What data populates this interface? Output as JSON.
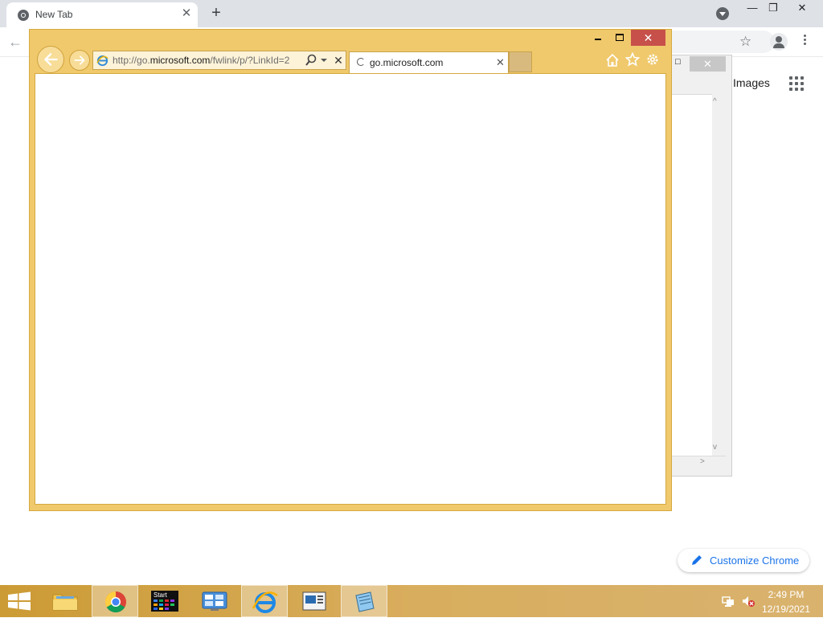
{
  "chrome": {
    "tab_title": "New Tab",
    "tab_close": "✕",
    "newtab": "+",
    "win_min": "—",
    "win_restore": "❐",
    "win_close": "✕",
    "back": "←",
    "star": "☆",
    "images_link": "Images",
    "customize_label": "Customize Chrome"
  },
  "bg_window": {
    "max": "□",
    "close": "✕",
    "scroll_up": "^",
    "scroll_down": "v",
    "scroll_right": ">"
  },
  "ie": {
    "close": "✕",
    "url_prefix": "http://go.",
    "url_domain": "microsoft.com",
    "url_path": "/fwlink/p/?LinkId=2",
    "stop": "✕",
    "tab_title": "go.microsoft.com",
    "tab_close": "✕",
    "accent_color": "#f0c96c"
  },
  "taskbar": {
    "items": [
      "start-button",
      "file-explorer",
      "google-chrome",
      "start-tiles",
      "control-panel",
      "internet-explorer",
      "screen-app",
      "notepad"
    ],
    "time": "2:49 PM",
    "date": "12/19/2021"
  }
}
